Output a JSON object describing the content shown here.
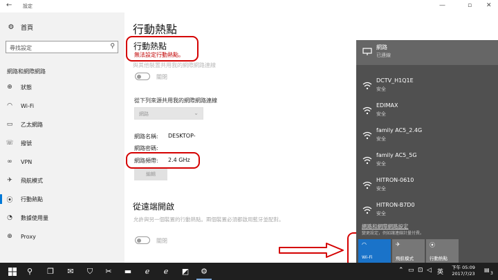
{
  "window": {
    "title": "設定",
    "back_icon": "back-arrow-icon",
    "minimize": "—",
    "maximize": "▫",
    "close": "✕"
  },
  "sidebar": {
    "home_label": "首頁",
    "search_placeholder": "尋找設定",
    "section_title": "網路和網際網路",
    "items": [
      {
        "label": "狀態",
        "icon": "globe-icon",
        "glyph": "⊕"
      },
      {
        "label": "Wi-Fi",
        "icon": "wifi-icon",
        "glyph": "◠"
      },
      {
        "label": "乙太網路",
        "icon": "ethernet-icon",
        "glyph": "▭"
      },
      {
        "label": "撥號",
        "icon": "dialup-icon",
        "glyph": "☏"
      },
      {
        "label": "VPN",
        "icon": "vpn-icon",
        "glyph": "∞"
      },
      {
        "label": "飛航模式",
        "icon": "airplane-icon",
        "glyph": "✈"
      },
      {
        "label": "行動熱點",
        "icon": "hotspot-icon",
        "glyph": "⦿"
      },
      {
        "label": "數據使用量",
        "icon": "data-usage-icon",
        "glyph": "◔"
      },
      {
        "label": "Proxy",
        "icon": "proxy-icon",
        "glyph": "⊕"
      }
    ],
    "active_index": 6
  },
  "main": {
    "page_title": "行動熱點",
    "sub_title": "行動熱點",
    "error_text": "無法設定行動熱點。",
    "share_desc": "與其他裝置共用我的網際網路連線",
    "toggle1_label": "關閉",
    "share_from_label": "從下列來源共用我的網際網路連線",
    "share_from_value": "網路",
    "network_name_label": "網路名稱:",
    "network_name_value": "DESKTOP-",
    "network_password_label": "網路密碼:",
    "network_band_label": "網路頻帶:",
    "network_band_value": "2.4 GHz",
    "edit_button": "編輯",
    "remote_title": "從遠端開啟",
    "remote_desc": "允許與另一個裝置的行動熱點。兩個裝置必須都啟用藍牙並配對。",
    "toggle2_label": "關閉"
  },
  "action_center": {
    "networks": [
      {
        "name": "網路",
        "status": "已連線",
        "icon": "network-icon"
      },
      {
        "name": "DCTV_H1Q1E",
        "status": "安全",
        "icon": "wifi-signal-icon"
      },
      {
        "name": "EDIMAX",
        "status": "安全",
        "icon": "wifi-signal-icon"
      },
      {
        "name": "family AC5_2.4G",
        "status": "安全",
        "icon": "wifi-signal-icon"
      },
      {
        "name": "family AC5_5G",
        "status": "安全",
        "icon": "wifi-signal-icon"
      },
      {
        "name": "HITRON-0610",
        "status": "安全",
        "icon": "wifi-signal-icon"
      },
      {
        "name": "HITRON-B7D0",
        "status": "安全",
        "icon": "wifi-signal-icon"
      }
    ],
    "settings_link": "網路和網際網路設定",
    "settings_sub": "變更設定，例如讓連線計量付費。",
    "tiles": [
      {
        "label": "Wi-Fi",
        "icon": "wifi-tile-icon",
        "glyph": "◠"
      },
      {
        "label": "飛航模式",
        "icon": "airplane-tile-icon",
        "glyph": "✈"
      },
      {
        "label": "行動熱點",
        "icon": "hotspot-tile-icon",
        "glyph": "⦿"
      }
    ]
  },
  "taskbar": {
    "ime": "英",
    "time": "下午 05:09",
    "date": "2017/7/23",
    "notification_count": "3"
  },
  "colors": {
    "accent": "#0078d7",
    "annotation_red": "#d40000",
    "action_center_bg": "#505050",
    "wifi_tile_on": "#1a73c9"
  }
}
